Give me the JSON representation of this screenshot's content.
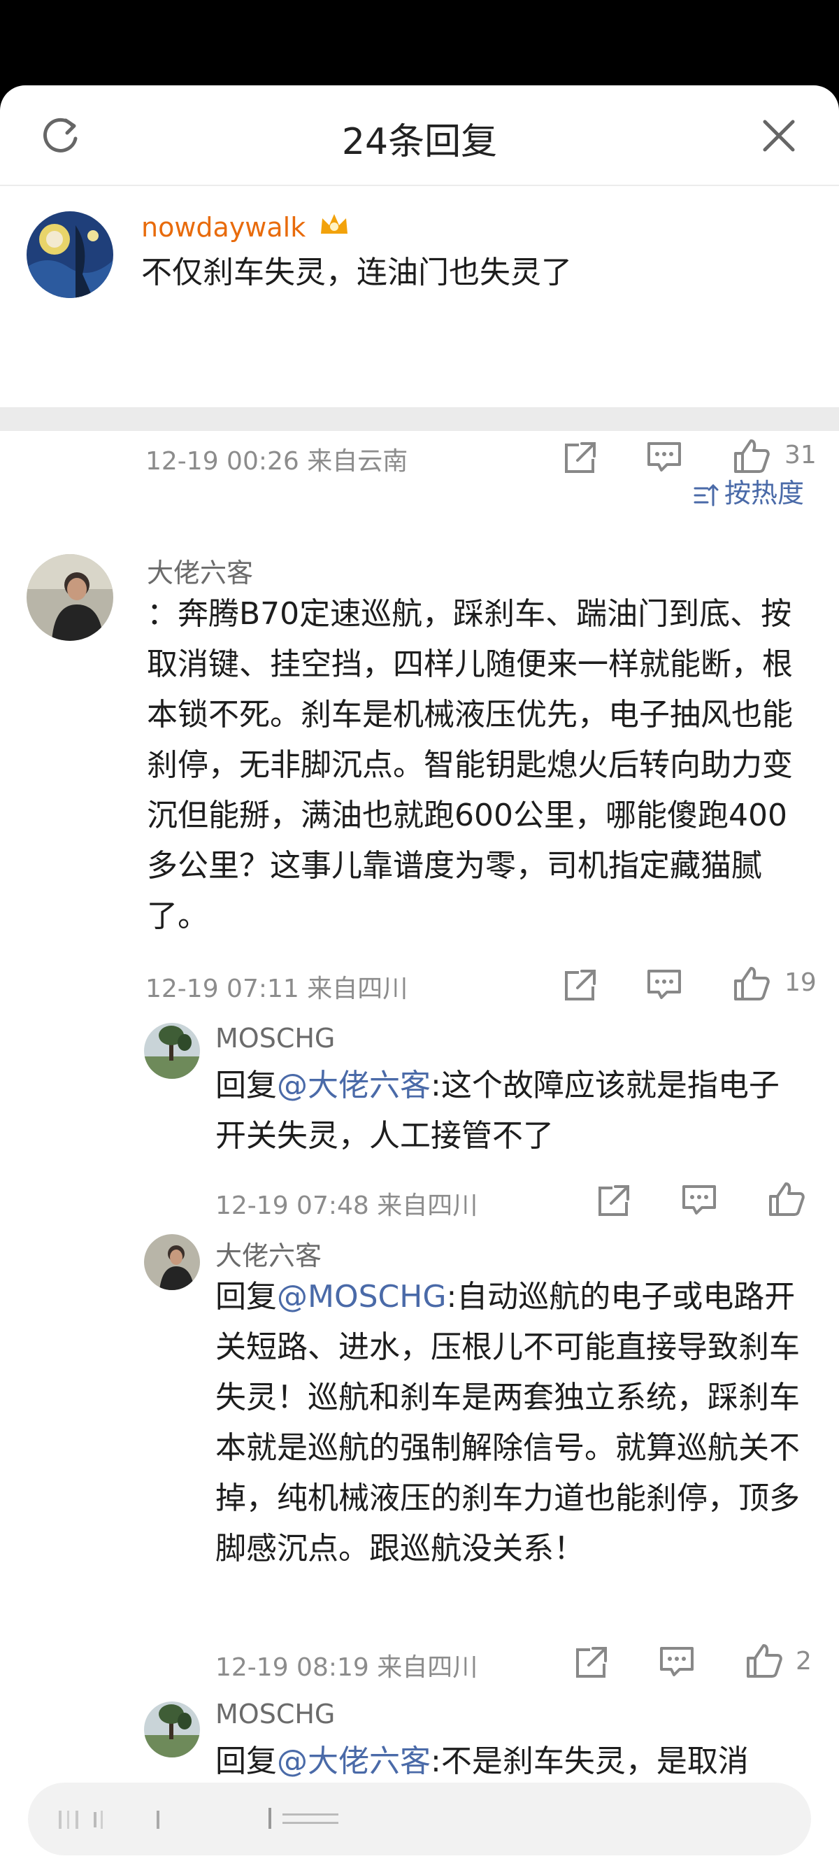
{
  "header": {
    "title": "24条回复"
  },
  "main_comment": {
    "username": "nowdaywalk",
    "text": "不仅刹车失灵，连油门也失灵了",
    "meta": "12-19 00:26  来自云南",
    "likes": "31"
  },
  "sort": {
    "label": "按热度"
  },
  "replies": [
    {
      "username": "大佬六客",
      "text": "：奔腾B70定速巡航，踩刹车、踹油门到底、按取消键、挂空挡，四样儿随便来一样就能断，根本锁不死。刹车是机械液压优先，电子抽风也能刹停，无非脚沉点。智能钥匙熄火后转向助力变沉但能掰，满油也就跑600公里，哪能傻跑400多公里？这事儿靠谱度为零，司机指定藏猫腻了。",
      "meta": "12-19 07:11  来自四川",
      "likes": "19"
    },
    {
      "username": "MOSCHG",
      "prefix": "回复",
      "mention": "@大佬六客",
      "text": ":这个故障应该就是指电子开关失灵，人工接管不了",
      "meta": "12-19 07:48  来自四川",
      "likes": ""
    },
    {
      "username": "大佬六客",
      "prefix": "回复",
      "mention": "@MOSCHG",
      "text": ":自动巡航的电子或电路开关短路、进水，压根儿不可能直接导致刹车失灵！巡航和刹车是两套独立系统，踩刹车本就是巡航的强制解除信号。就算巡航关不掉，纯机械液压的刹车力道也能刹停，顶多脚感沉点。跟巡航没关系！",
      "meta": "12-19 08:19  来自四川",
      "likes": "2"
    },
    {
      "username": "MOSCHG",
      "prefix": "回复",
      "mention": "@大佬六客",
      "text": ":不是刹车失灵，是取消"
    }
  ],
  "colors": {
    "accent": "#4a6aa8",
    "vip_orange": "#e86b0c",
    "meta": "#8c8c8c"
  }
}
